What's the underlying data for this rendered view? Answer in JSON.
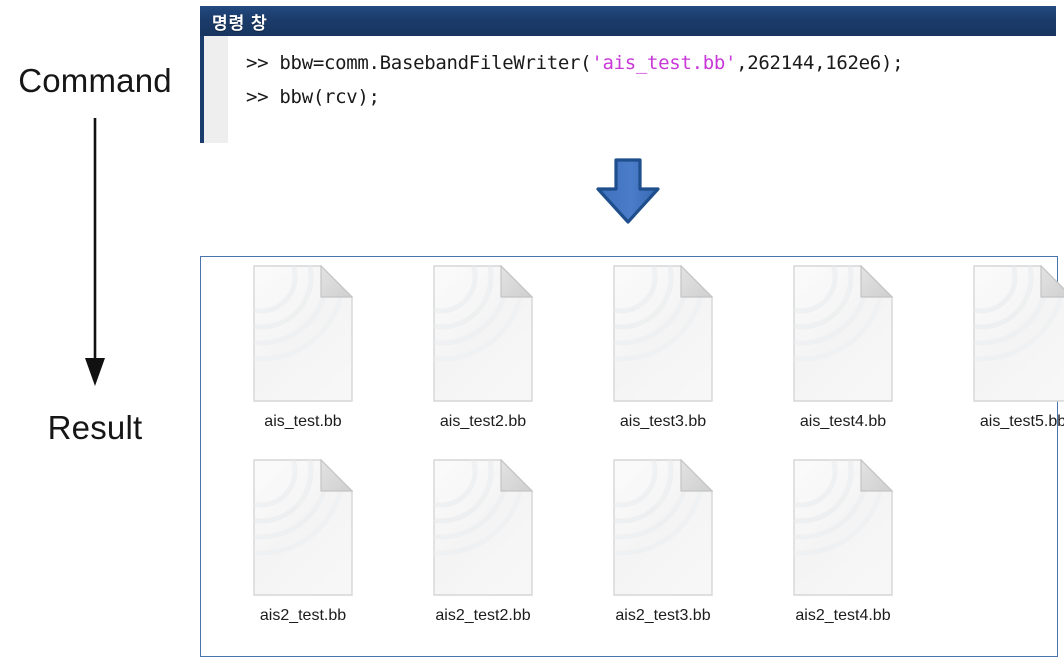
{
  "annotations": {
    "command_label": "Command",
    "result_label": "Result",
    "flow_arrow_icon": "down-arrow-icon",
    "transition_arrow_icon": "blue-down-arrow-icon"
  },
  "command_window": {
    "title": "명령 창",
    "title_bar_color": "#1b3d6e",
    "lines": [
      {
        "prompt": ">> ",
        "segments": [
          {
            "text": "bbw=comm.BasebandFileWriter(",
            "color": "#1a1a1a"
          },
          {
            "text": "'ais_test.bb'",
            "color": "#c838d8"
          },
          {
            "text": ",262144,162e6);",
            "color": "#1a1a1a"
          }
        ],
        "plain": ">> bbw=comm.BasebandFileWriter('ais_test.bb',262144,162e6);"
      },
      {
        "prompt": ">> ",
        "segments": [
          {
            "text": "bbw(rcv);",
            "color": "#1a1a1a"
          }
        ],
        "plain": ">> bbw(rcv);"
      }
    ]
  },
  "file_panel": {
    "border_color": "#4a72ad",
    "icon_name": "file-document-icon",
    "rows": [
      [
        {
          "name": "ais_test.bb"
        },
        {
          "name": "ais_test2.bb"
        },
        {
          "name": "ais_test3.bb"
        },
        {
          "name": "ais_test4.bb"
        },
        {
          "name": "ais_test5.bb"
        }
      ],
      [
        {
          "name": "ais2_test.bb"
        },
        {
          "name": "ais2_test2.bb"
        },
        {
          "name": "ais2_test3.bb"
        },
        {
          "name": "ais2_test4.bb"
        }
      ]
    ]
  }
}
